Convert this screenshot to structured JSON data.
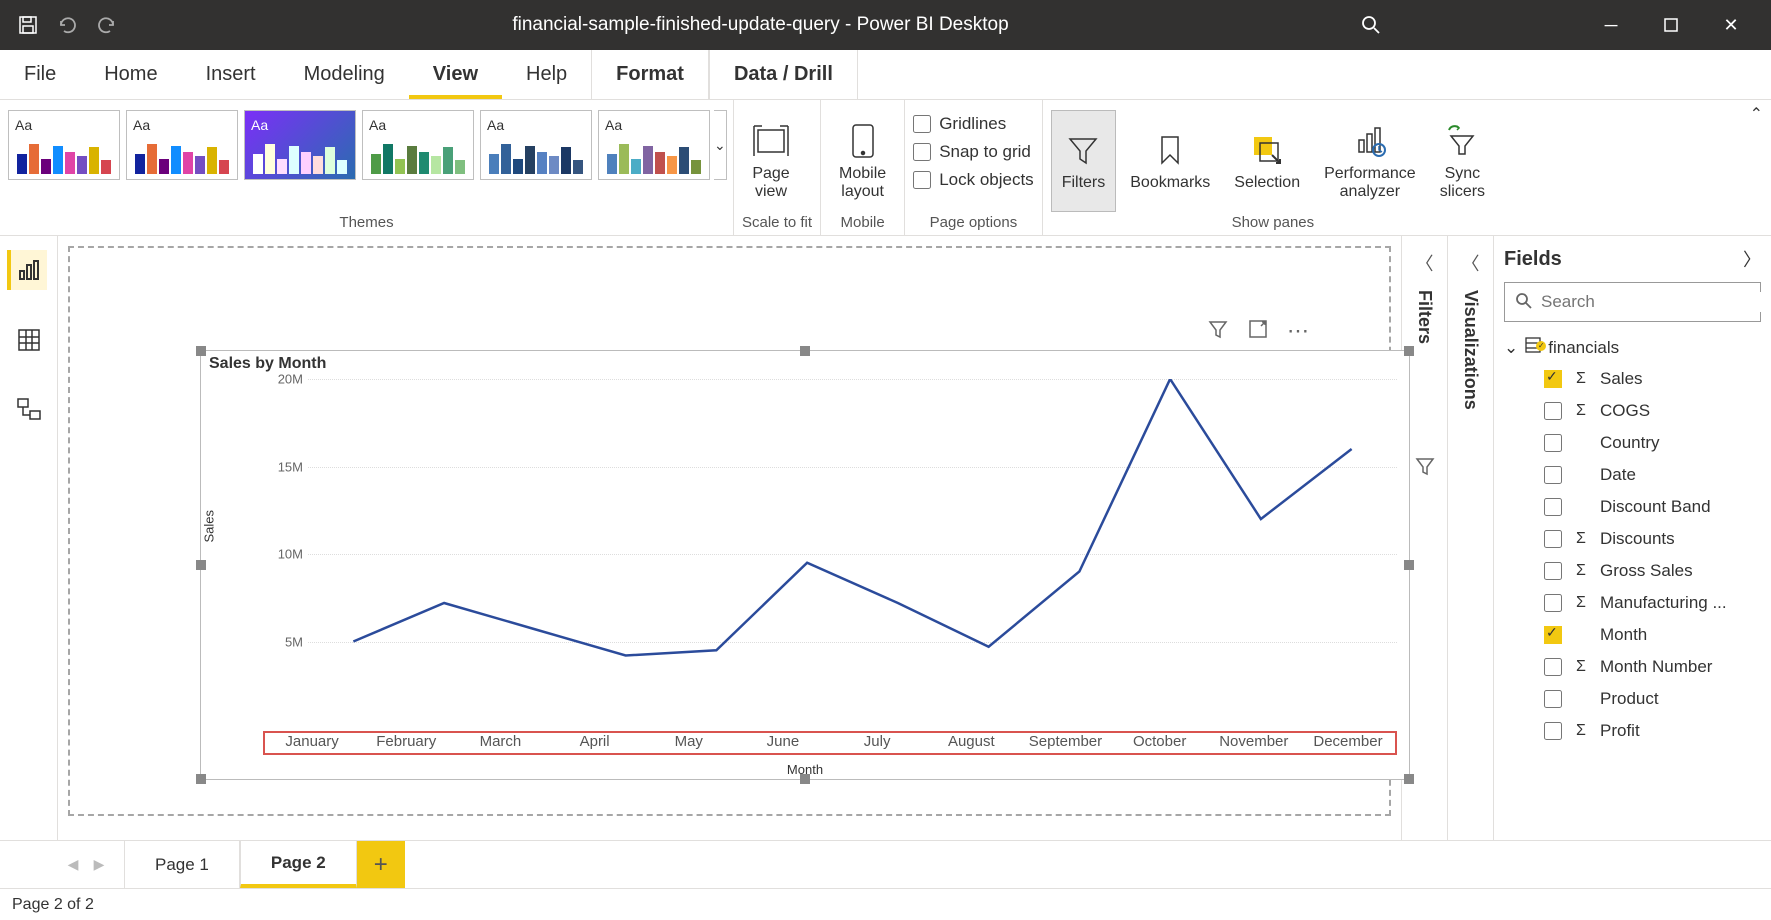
{
  "app_title": "financial-sample-finished-update-query - Power BI Desktop",
  "menu": {
    "file": "File",
    "home": "Home",
    "insert": "Insert",
    "modeling": "Modeling",
    "view": "View",
    "help": "Help",
    "format": "Format",
    "datadrill": "Data / Drill"
  },
  "ribbon": {
    "themes_label": "Themes",
    "scale_label": "Scale to fit",
    "mobile_label": "Mobile",
    "page_options_label": "Page options",
    "show_panes_label": "Show panes",
    "page_view": "Page\nview",
    "mobile_layout": "Mobile\nlayout",
    "gridlines": "Gridlines",
    "snap": "Snap to grid",
    "lock": "Lock objects",
    "filters": "Filters",
    "bookmarks": "Bookmarks",
    "selection": "Selection",
    "performance": "Performance\nanalyzer",
    "sync": "Sync\nslicers"
  },
  "panes": {
    "filters": "Filters",
    "visualizations": "Visualizations",
    "fields": "Fields"
  },
  "search_placeholder": "Search",
  "table_name": "financials",
  "fields": [
    {
      "name": "Sales",
      "checked": true,
      "sigma": true
    },
    {
      "name": "COGS",
      "checked": false,
      "sigma": true
    },
    {
      "name": "Country",
      "checked": false,
      "sigma": false
    },
    {
      "name": "Date",
      "checked": false,
      "sigma": false
    },
    {
      "name": "Discount Band",
      "checked": false,
      "sigma": false
    },
    {
      "name": "Discounts",
      "checked": false,
      "sigma": true
    },
    {
      "name": "Gross Sales",
      "checked": false,
      "sigma": true
    },
    {
      "name": "Manufacturing ...",
      "checked": false,
      "sigma": true
    },
    {
      "name": "Month",
      "checked": true,
      "sigma": false
    },
    {
      "name": "Month Number",
      "checked": false,
      "sigma": true
    },
    {
      "name": "Product",
      "checked": false,
      "sigma": false
    },
    {
      "name": "Profit",
      "checked": false,
      "sigma": true
    }
  ],
  "tabs": {
    "page1": "Page 1",
    "page2": "Page 2"
  },
  "status": "Page 2 of 2",
  "chart_data": {
    "type": "line",
    "title": "Sales by Month",
    "xlabel": "Month",
    "ylabel": "Sales",
    "ylim": [
      0,
      20000000
    ],
    "y_ticks": [
      "5M",
      "10M",
      "15M",
      "20M"
    ],
    "categories": [
      "January",
      "February",
      "March",
      "April",
      "May",
      "June",
      "July",
      "August",
      "September",
      "October",
      "November",
      "December"
    ],
    "values": [
      5000000,
      7200000,
      5700000,
      4200000,
      4500000,
      9500000,
      7200000,
      4700000,
      9000000,
      20000000,
      12000000,
      16000000
    ]
  }
}
